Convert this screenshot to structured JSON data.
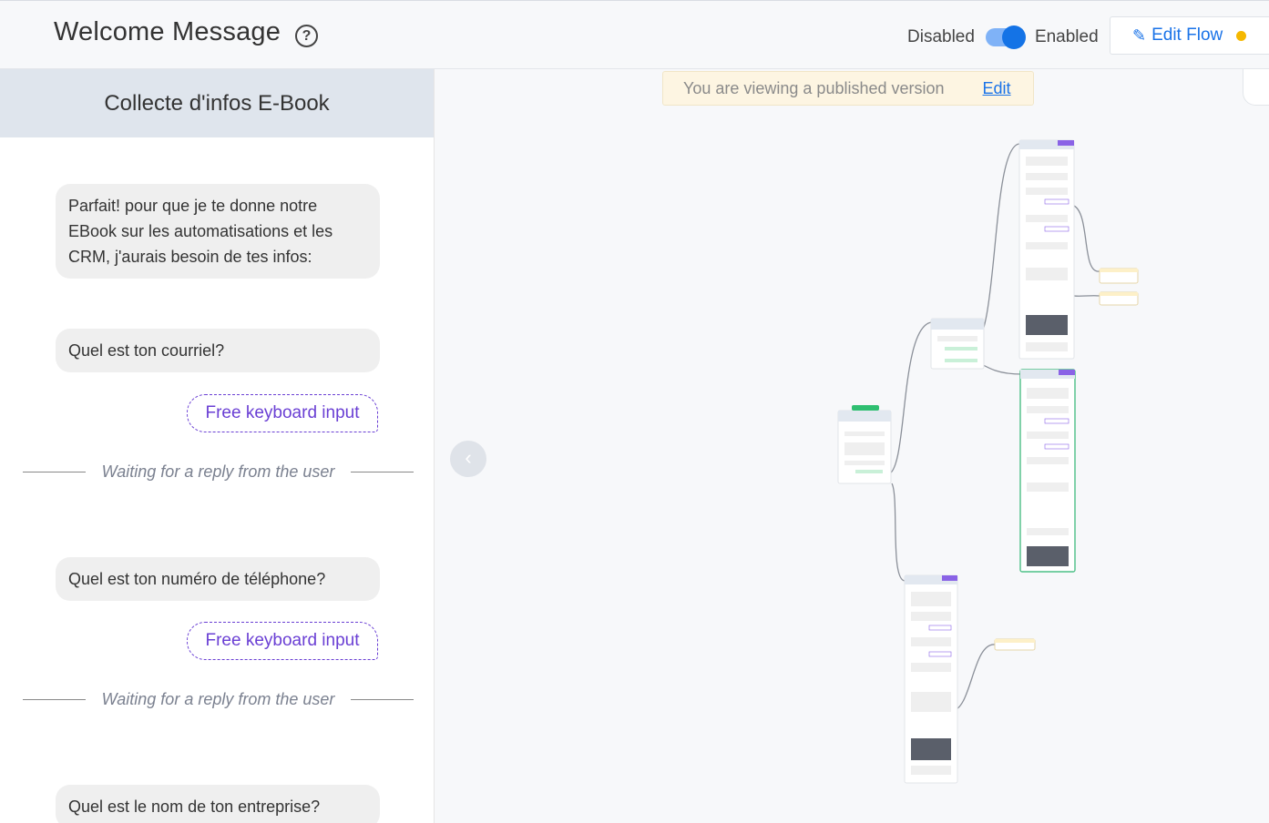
{
  "header": {
    "title": "Welcome Message",
    "help_icon": "question-circle-icon",
    "toggle_off_label": "Disabled",
    "toggle_on_label": "Enabled",
    "toggle_state": "enabled",
    "edit_flow_label": "Edit Flow",
    "edit_flow_icon": "pencil-icon",
    "status_dot_color": "#f5b800"
  },
  "panel": {
    "title": "Collecte d'infos E-Book",
    "messages": [
      {
        "text": "Parfait! pour que je te donne notre EBook sur les automatisations et les CRM, j'aurais besoin de tes infos:"
      },
      {
        "text": "Quel est ton courriel?"
      },
      {
        "text": "Quel est ton numéro de téléphone?"
      },
      {
        "text": "Quel est le nom de ton entreprise?"
      }
    ],
    "input_label": "Free keyboard input",
    "waiting_label": "Waiting for a reply from the user"
  },
  "canvas": {
    "banner_text": "You are viewing a published version",
    "banner_link": "Edit",
    "collapse_icon": "chevron-left-icon",
    "accent_purple": "#6a3fd4",
    "accent_blue": "#1a73e8"
  }
}
